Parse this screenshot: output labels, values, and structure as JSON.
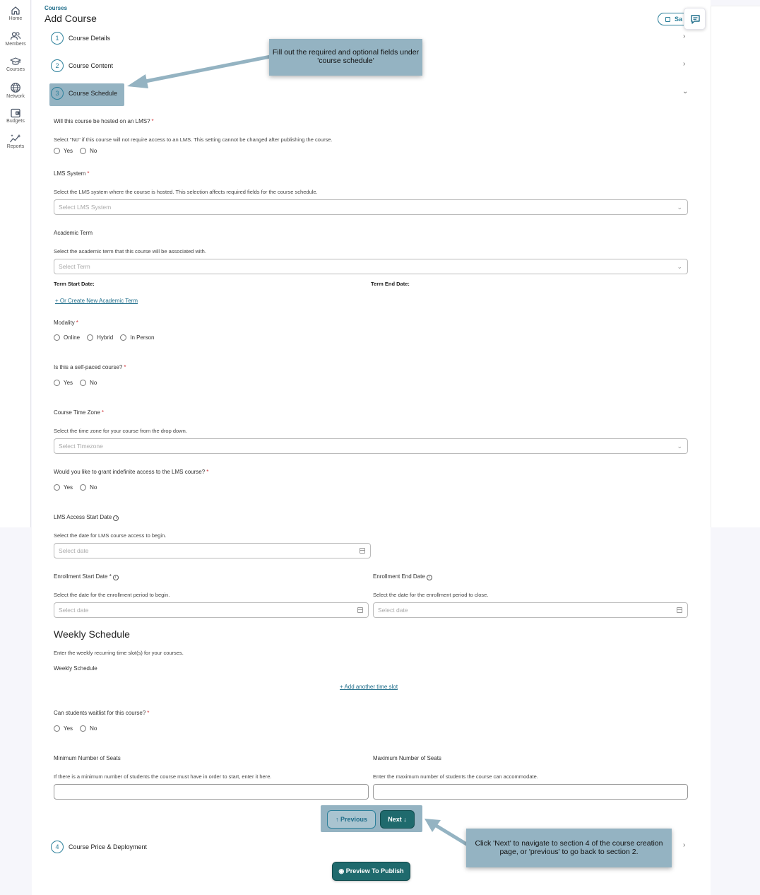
{
  "sidebar": {
    "items": [
      {
        "label": "Home",
        "icon": "home-icon"
      },
      {
        "label": "Members",
        "icon": "members-icon"
      },
      {
        "label": "Courses",
        "icon": "graduation-cap-icon"
      },
      {
        "label": "Network",
        "icon": "globe-icon"
      },
      {
        "label": "Budgets",
        "icon": "wallet-icon"
      },
      {
        "label": "Reports",
        "icon": "sparkle-chart-icon"
      }
    ]
  },
  "header": {
    "breadcrumb": "Courses",
    "title": "Add Course",
    "save_label": "Sa"
  },
  "steps": [
    {
      "number": "1",
      "label": "Course Details"
    },
    {
      "number": "2",
      "label": "Course Content"
    },
    {
      "number": "3",
      "label": "Course Schedule"
    },
    {
      "number": "4",
      "label": "Course Price & Deployment"
    }
  ],
  "form": {
    "lms_hosted": {
      "label": "Will this course be hosted on an LMS?",
      "help": "Select \"No\" if this course will not require access to an LMS. This setting cannot be changed after publishing the course.",
      "options": [
        "Yes",
        "No"
      ]
    },
    "lms_system": {
      "label": "LMS System",
      "help": "Select the LMS system where the course is hosted. This selection affects required fields for the course schedule.",
      "placeholder": "Select LMS System"
    },
    "academic_term": {
      "label": "Academic Term",
      "help": "Select the academic term that this course will be associated with.",
      "placeholder": "Select Term",
      "start_label": "Term Start Date:",
      "end_label": "Term End Date:",
      "create_link": "+ Or Create New Academic Term"
    },
    "modality": {
      "label": "Modality",
      "options": [
        "Online",
        "Hybrid",
        "In Person"
      ]
    },
    "self_paced": {
      "label": "Is this a self-paced course?",
      "options": [
        "Yes",
        "No"
      ]
    },
    "time_zone": {
      "label": "Course Time Zone",
      "help": "Select the time zone for your course from the drop down.",
      "placeholder": "Select Timezone"
    },
    "indefinite_access": {
      "label": "Would you like to grant indefinite access to the LMS course?",
      "options": [
        "Yes",
        "No"
      ]
    },
    "lms_access_start": {
      "label": "LMS Access Start Date",
      "help": "Select the date for LMS course access to begin.",
      "placeholder": "Select date"
    },
    "enrollment_start": {
      "label": "Enrollment Start Date *",
      "help": "Select the date for the enrollment period to begin.",
      "placeholder": "Select date"
    },
    "enrollment_end": {
      "label": "Enrollment End Date",
      "help": "Select the date for the enrollment period to close.",
      "placeholder": "Select date"
    },
    "weekly_schedule": {
      "heading": "Weekly Schedule",
      "help": "Enter the weekly recurring time slot(s) for your courses.",
      "label": "Weekly Schedule",
      "add_link": "+ Add another time slot"
    },
    "waitlist": {
      "label": "Can students waitlist for this course?",
      "options": [
        "Yes",
        "No"
      ]
    },
    "min_seats": {
      "label": "Minimum Number of Seats",
      "help": "If there is a minimum number of students the course must have in order to start, enter it here."
    },
    "max_seats": {
      "label": "Maximum Number of Seats",
      "help": "Enter the maximum number of students the course can accommodate."
    },
    "required_mark": "*"
  },
  "buttons": {
    "previous": "↑ Previous",
    "next": "Next ↓",
    "preview": "Preview To Publish"
  },
  "callouts": {
    "top": "Fill out the required and optional fields under 'course schedule'",
    "bottom": "Click 'Next' to navigate to section 4 of the course creation page, or 'previous' to go back to section 2."
  },
  "colors": {
    "accent": "#2b7f9a",
    "primary_button": "#1f6a6d",
    "callout": "#94b3c2",
    "required": "#d0343a"
  }
}
